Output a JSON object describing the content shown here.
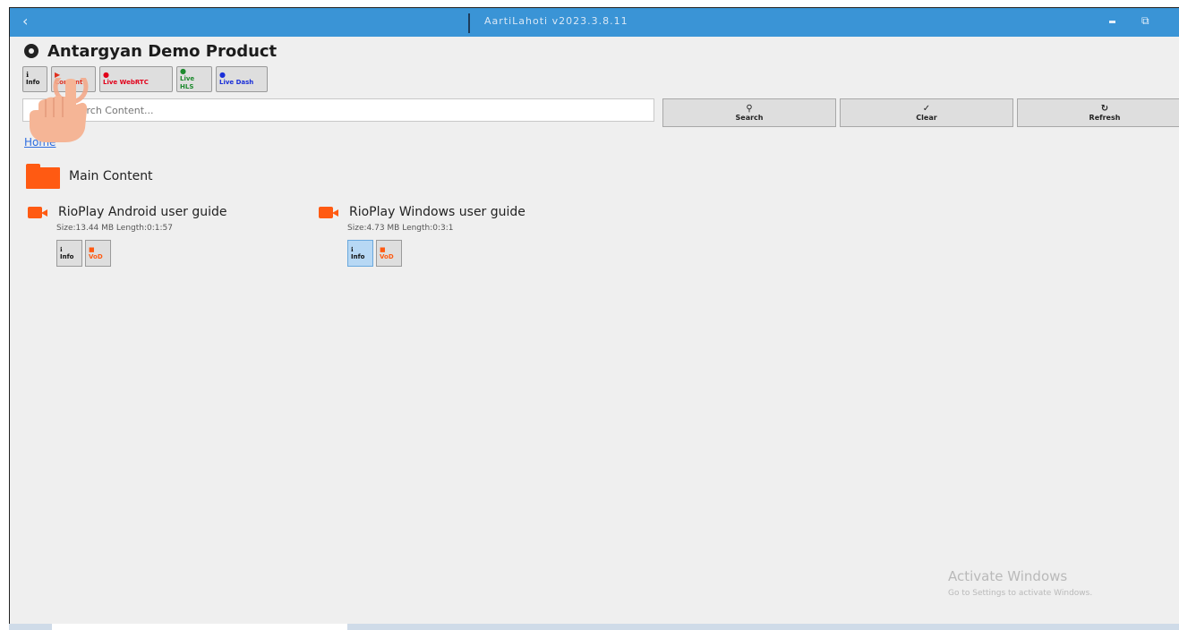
{
  "window": {
    "title": "AartiLahoti v2023.3.8.11",
    "back_icon": "‹",
    "minimize_icon": "minimize-icon",
    "maximize_icon": "maximize-icon"
  },
  "product": {
    "title": "Antargyan Demo Product",
    "icon": "gear-icon"
  },
  "toolbar": [
    {
      "label": "Info",
      "icon": "ℹ",
      "color": "#111111"
    },
    {
      "label": "Content",
      "icon": "▶",
      "color": "#e0301e"
    },
    {
      "label": "Live WebRTC",
      "icon": "●",
      "color": "#e2001a"
    },
    {
      "label": "Live HLS",
      "icon": "●",
      "color": "#1d8a2e"
    },
    {
      "label": "Live Dash",
      "icon": "●",
      "color": "#1a2fd8"
    }
  ],
  "search": {
    "placeholder": "Search Content...",
    "search_label": "Search",
    "clear_label": "Clear",
    "refresh_label": "Refresh"
  },
  "breadcrumb": {
    "home": "Home"
  },
  "folder": {
    "label": "Main Content",
    "color": "#ff5a12"
  },
  "videos": [
    {
      "title": "RioPlay Android user guide",
      "meta": "Size:13.44 MB  Length:0:1:57",
      "info_label": "Info",
      "vod_label": "VoD"
    },
    {
      "title": "RioPlay Windows user guide",
      "meta": "Size:4.73 MB  Length:0:3:1",
      "info_label": "Info",
      "vod_label": "VoD"
    }
  ],
  "watermark": {
    "line1": "Activate Windows",
    "line2": "Go to Settings to activate Windows."
  }
}
